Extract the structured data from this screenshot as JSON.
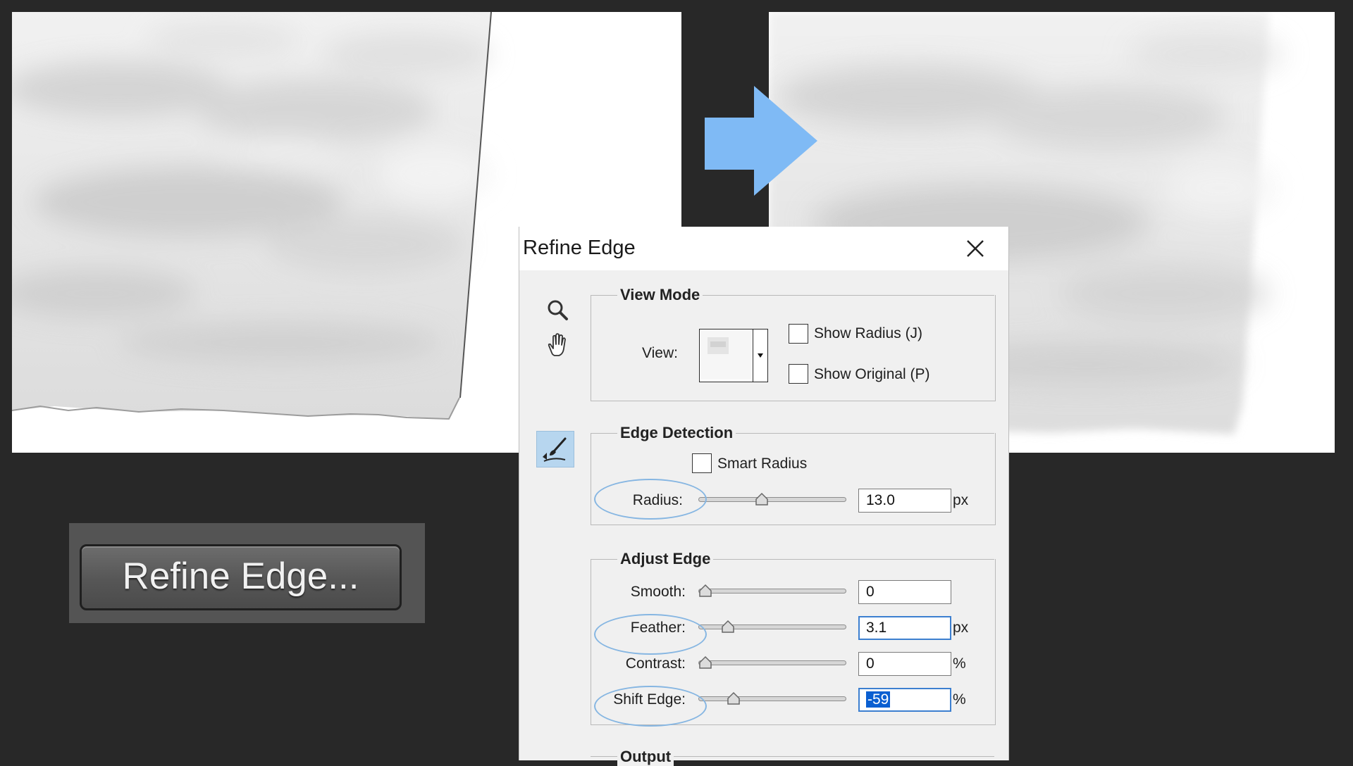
{
  "refine_button": {
    "label": "Refine Edge..."
  },
  "dialog": {
    "title": "Refine Edge",
    "close_icon": "close-icon",
    "tools": [
      "zoom-icon",
      "hand-icon",
      "refine-radius-brush-icon"
    ],
    "view_mode": {
      "title": "View Mode",
      "view_label": "View:",
      "show_radius": {
        "label": "Show Radius (J)",
        "checked": false
      },
      "show_original": {
        "label": "Show Original (P)",
        "checked": false
      }
    },
    "edge_detection": {
      "title": "Edge Detection",
      "smart_radius": {
        "label": "Smart Radius",
        "checked": false
      },
      "radius": {
        "label": "Radius:",
        "value": "13.0",
        "unit": "px",
        "slider_fraction": 0.42
      }
    },
    "adjust_edge": {
      "title": "Adjust Edge",
      "smooth": {
        "label": "Smooth:",
        "value": "0",
        "unit": "",
        "slider_fraction": 0.0
      },
      "feather": {
        "label": "Feather:",
        "value": "3.1",
        "unit": "px",
        "slider_fraction": 0.17
      },
      "contrast": {
        "label": "Contrast:",
        "value": "0",
        "unit": "%",
        "slider_fraction": 0.0
      },
      "shift_edge": {
        "label": "Shift Edge:",
        "value": "-59",
        "unit": "%",
        "slider_fraction": 0.21
      }
    },
    "output": {
      "title": "Output"
    }
  },
  "colors": {
    "background": "#282828",
    "arrow": "#7fbaf5",
    "highlight_ellipse": "#86b6e2",
    "selection": "#0a5fd1"
  }
}
